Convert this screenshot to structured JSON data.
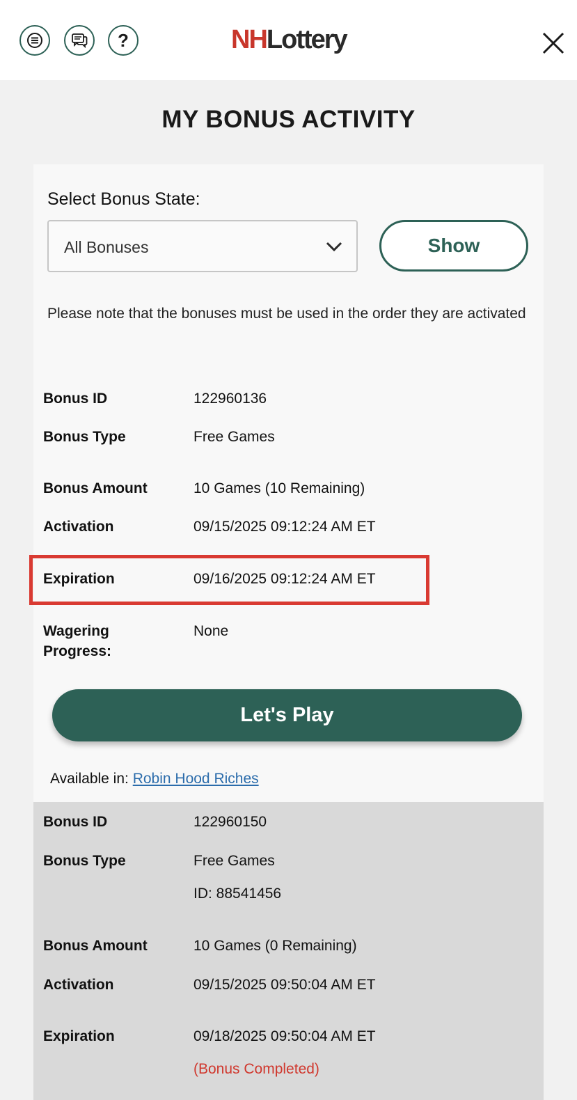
{
  "header": {
    "logo_prefix": "NH",
    "logo_rest": "Lottery",
    "icons": [
      "menu-icon",
      "chat-icon",
      "help-icon",
      "close-icon"
    ]
  },
  "page_title": "MY BONUS ACTIVITY",
  "filter": {
    "label": "Select Bonus State:",
    "selected": "All Bonuses",
    "show_label": "Show"
  },
  "note": "Please note that the bonuses must be used in the order they are activated",
  "bonus1": {
    "id_label": "Bonus ID",
    "id_value": "122960136",
    "type_label": "Bonus Type",
    "type_value": "Free Games",
    "amount_label": "Bonus Amount",
    "amount_value": "10 Games (10 Remaining)",
    "activation_label": "Activation",
    "activation_value": "09/15/2025 09:12:24 AM ET",
    "expiration_label": "Expiration",
    "expiration_value": "09/16/2025 09:12:24 AM ET",
    "wagering_label_1": "Wagering",
    "wagering_label_2": "Progress:",
    "wagering_value": "None",
    "play_label": "Let's Play",
    "available_label": "Available in:",
    "available_link": "Robin Hood Riches"
  },
  "bonus2": {
    "id_label": "Bonus ID",
    "id_value": "122960150",
    "type_label": "Bonus Type",
    "type_value": "Free Games",
    "type_sub": "ID: 88541456",
    "amount_label": "Bonus Amount",
    "amount_value": "10 Games (0 Remaining)",
    "activation_label": "Activation",
    "activation_value": "09/15/2025 09:50:04 AM ET",
    "expiration_label": "Expiration",
    "expiration_value": "09/18/2025 09:50:04 AM ET",
    "status": "(Bonus Completed)"
  },
  "colors": {
    "brand_green": "#2d6156",
    "highlight_red": "#d93a32",
    "completed_red": "#d0382e",
    "link_blue": "#2b6cab"
  }
}
